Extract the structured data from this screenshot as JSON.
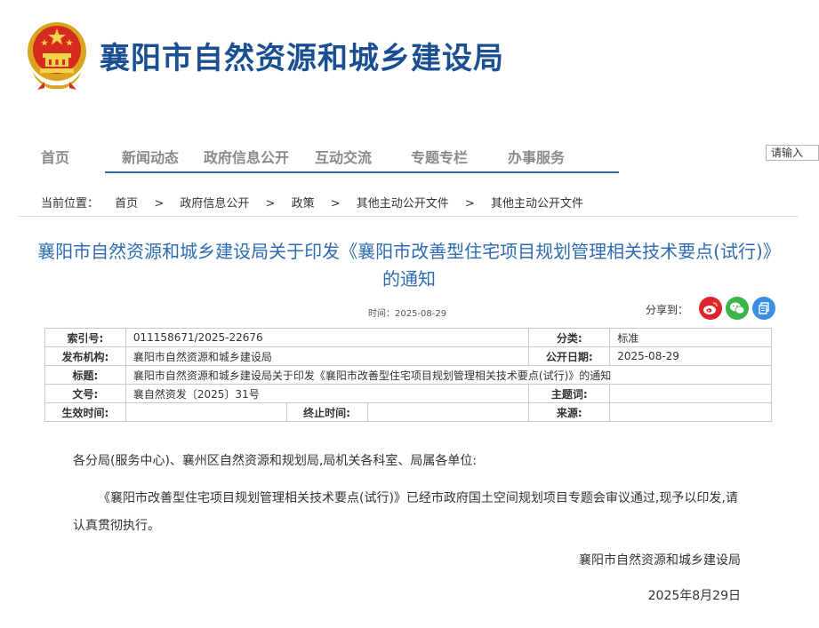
{
  "header": {
    "site_title": "襄阳市自然资源和城乡建设局"
  },
  "nav": {
    "items": [
      "首页",
      "新闻动态",
      "政府信息公开",
      "互动交流",
      "专题专栏",
      "办事服务"
    ]
  },
  "search": {
    "placeholder": "请输入"
  },
  "breadcrumb": {
    "prefix": "当前位置：",
    "items": [
      "首页",
      "政府信息公开",
      "政策",
      "其他主动公开文件",
      "其他主动公开文件"
    ],
    "separator": ">"
  },
  "article": {
    "title": "襄阳市自然资源和城乡建设局关于印发《襄阳市改善型住宅项目规划管理相关技术要点(试行)》的通知",
    "date_line": "时间：2025-08-29",
    "share_label": "分享到："
  },
  "meta": {
    "index_no_label": "索引号:",
    "index_no": "011158671/2025-22676",
    "category_label": "分类:",
    "category": "标准",
    "publisher_label": "发布机构:",
    "publisher": "襄阳市自然资源和城乡建设局",
    "pub_date_label": "公开日期:",
    "pub_date": "2025-08-29",
    "title_label": "标题:",
    "title": "襄阳市自然资源和城乡建设局关于印发《襄阳市改善型住宅项目规划管理相关技术要点(试行)》的通知",
    "doc_no_label": "文号:",
    "doc_no": "襄自然资发〔2025〕31号",
    "subject_label": "主题词:",
    "subject": "",
    "effective_label": "生效时间:",
    "effective": "",
    "expire_label": "终止时间:",
    "expire": "",
    "source_label": "来源:",
    "source": ""
  },
  "body": {
    "salutation": "各分局(服务中心)、襄州区自然资源和规划局,局机关各科室、局属各单位:",
    "paragraph": "《襄阳市改善型住宅项目规划管理相关技术要点(试行)》已经市政府国土空间规划项目专题会审议通过,现予以印发,请认真贯彻执行。",
    "sign_org": "襄阳市自然资源和城乡建设局",
    "sign_date": "2025年8月29日"
  },
  "colors": {
    "brand_blue": "#1a4f92",
    "title_blue": "#2e6bb5",
    "weibo_red": "#e0232d",
    "wechat_green": "#39b54a",
    "copy_blue": "#3a8ee6"
  },
  "icons": {
    "emblem": "national-emblem-icon",
    "weibo": "weibo-icon",
    "wechat": "wechat-icon",
    "copy": "copy-link-icon"
  }
}
